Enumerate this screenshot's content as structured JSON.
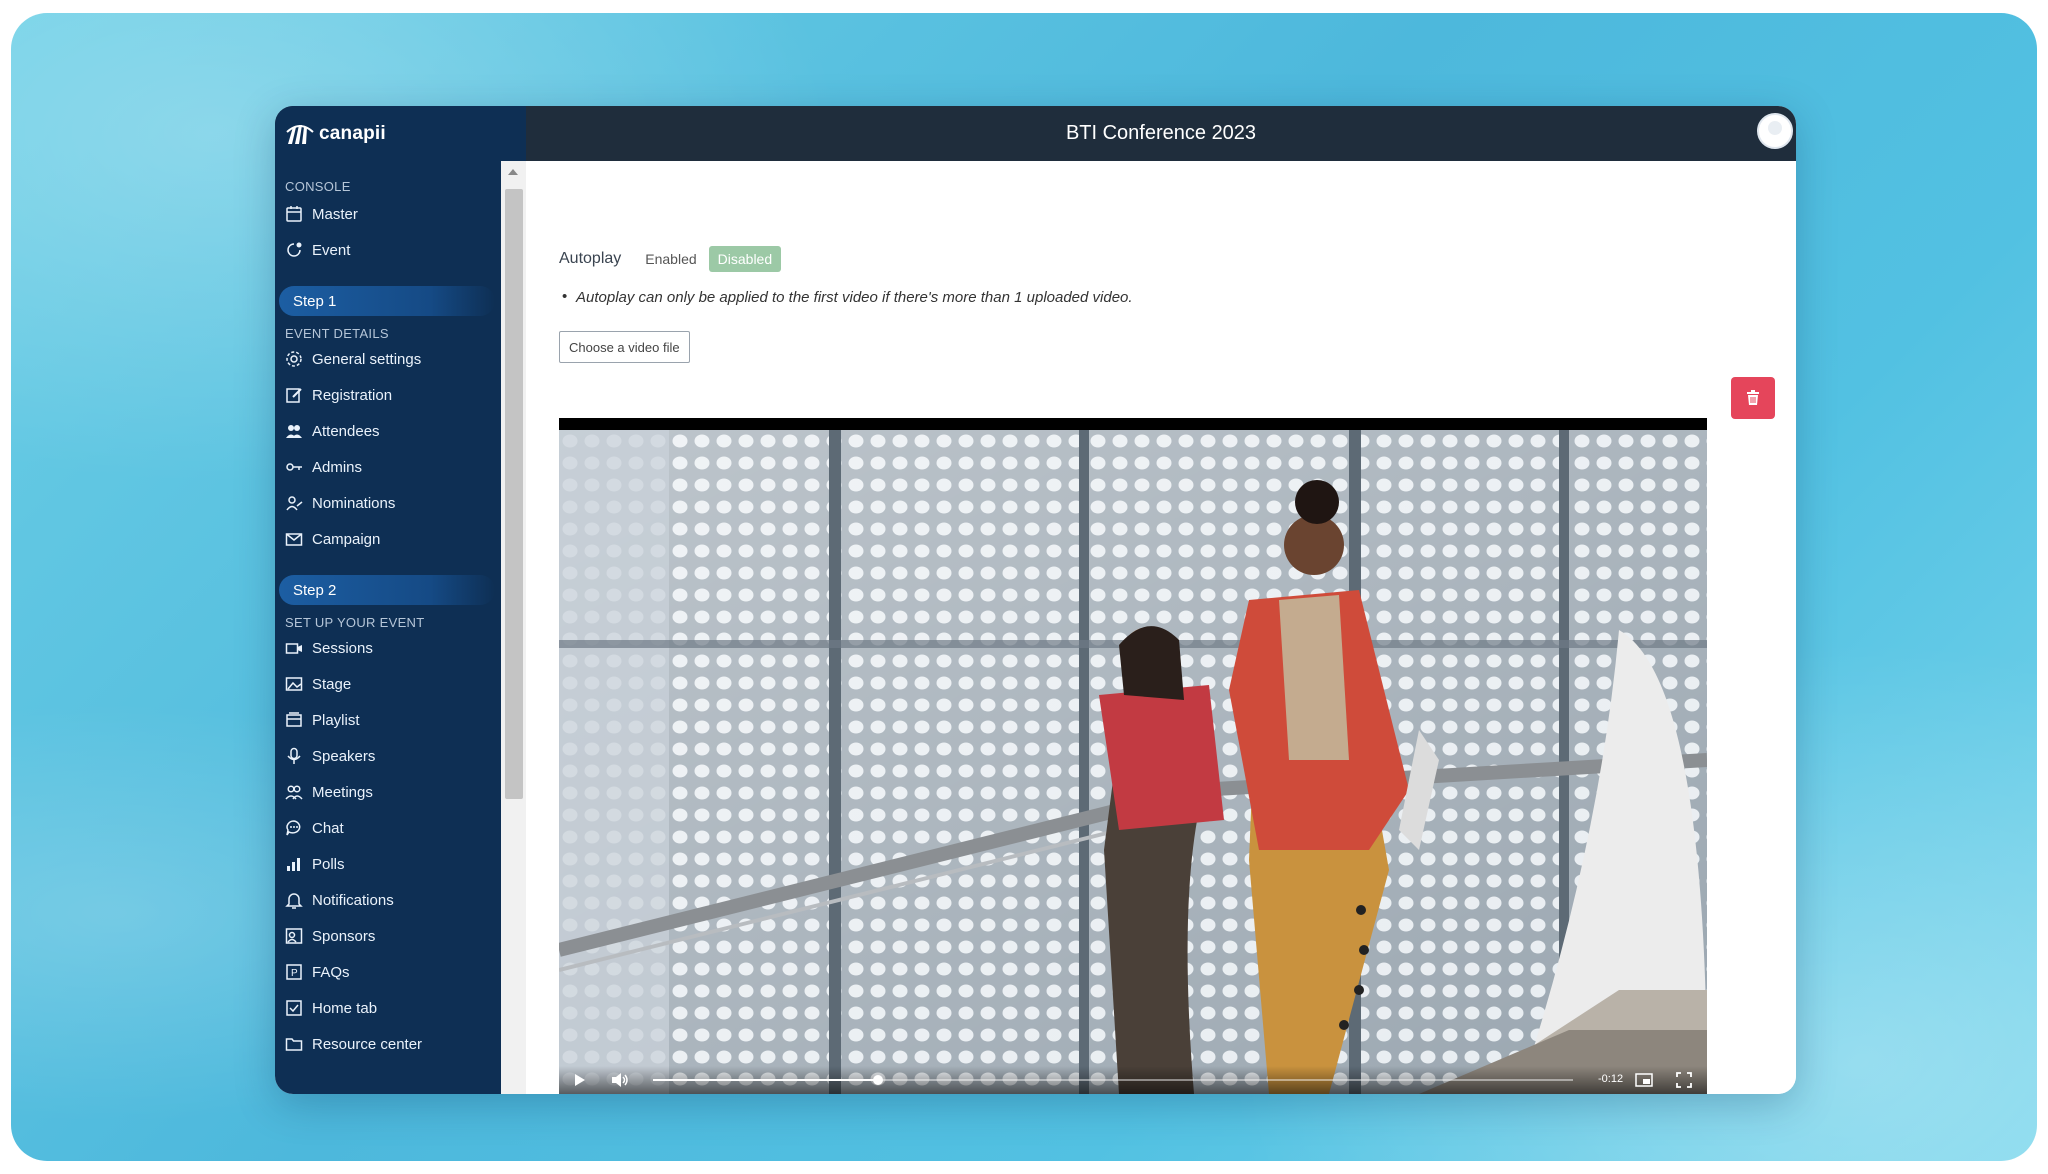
{
  "app": {
    "brand": "canapii",
    "window_title": "BTI Conference 2023"
  },
  "sidebar": {
    "console_label": "CONSOLE",
    "console_items": [
      {
        "label": "Master",
        "icon": "calendar-icon"
      },
      {
        "label": "Event",
        "icon": "event-icon"
      }
    ],
    "step1_label": "Step 1",
    "event_details_label": "EVENT DETAILS",
    "event_details_items": [
      {
        "label": "General settings",
        "icon": "gear-icon"
      },
      {
        "label": "Registration",
        "icon": "edit-icon"
      },
      {
        "label": "Attendees",
        "icon": "people-icon"
      },
      {
        "label": "Admins",
        "icon": "key-icon"
      },
      {
        "label": "Nominations",
        "icon": "user-add-icon"
      },
      {
        "label": "Campaign",
        "icon": "envelope-icon"
      }
    ],
    "step2_label": "Step 2",
    "setup_label": "SET UP YOUR EVENT",
    "setup_items": [
      {
        "label": "Sessions",
        "icon": "video-camera-icon"
      },
      {
        "label": "Stage",
        "icon": "image-icon"
      },
      {
        "label": "Playlist",
        "icon": "playlist-icon"
      },
      {
        "label": "Speakers",
        "icon": "microphone-icon"
      },
      {
        "label": "Meetings",
        "icon": "people-icon"
      },
      {
        "label": "Chat",
        "icon": "chat-icon"
      },
      {
        "label": "Polls",
        "icon": "bar-chart-icon"
      },
      {
        "label": "Notifications",
        "icon": "bell-icon"
      },
      {
        "label": "Sponsors",
        "icon": "sponsors-icon"
      },
      {
        "label": "FAQs",
        "icon": "faq-icon"
      },
      {
        "label": "Home tab",
        "icon": "checkbox-icon"
      },
      {
        "label": "Resource center",
        "icon": "folder-icon"
      }
    ]
  },
  "main": {
    "autoplay_label": "Autoplay",
    "autoplay_enabled": "Enabled",
    "autoplay_disabled": "Disabled",
    "autoplay_selected": "Disabled",
    "autoplay_note": "Autoplay can only be applied to the first video if there's more than 1 uploaded video.",
    "choose_video_label": "Choose a video file",
    "delete_icon": "trash-icon",
    "video": {
      "time_remaining": "-0:12",
      "progress_fraction": 0.245
    }
  },
  "colors": {
    "sidebar_bg": "#0e2f54",
    "topbar_bg": "#1f2d3c",
    "disabled_toggle": "#9cc9a6",
    "delete_button": "#e5455b"
  }
}
